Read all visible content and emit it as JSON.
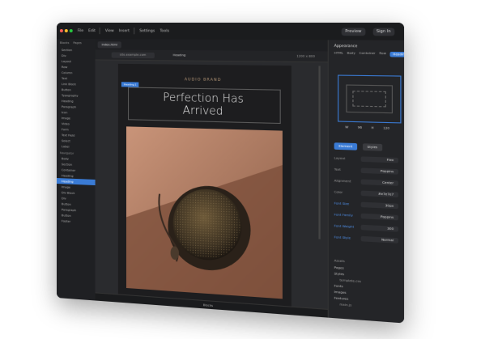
{
  "topbar": {
    "buttons": [
      "File",
      "Edit",
      "View",
      "Insert",
      "Settings",
      "Tools"
    ],
    "preview_label": "Preview",
    "signin_label": "Sign In"
  },
  "left": {
    "tabs": [
      "Blocks",
      "Pages"
    ],
    "items": [
      "Section",
      "Div",
      "Layout",
      "Row",
      "Column",
      "Text",
      "Link Block",
      "Button",
      "Typography",
      "Heading",
      "Paragraph",
      "Icon",
      "Image",
      "Video",
      "Form",
      "Text Field",
      "Select",
      "Label"
    ],
    "section_label": "Navigator",
    "nav_items": [
      "Body",
      "Section",
      "Container",
      "Heading",
      "Heading",
      "Image",
      "Div Block",
      "Div",
      "Button",
      "Paragraph",
      "Button",
      "Footer"
    ],
    "selected_nav_index": 4
  },
  "canvas": {
    "tab_label": "index.html",
    "url": "site.example.com",
    "heading_tag": "Heading",
    "size_label": "1200 x 800",
    "brand": "AUDIO BRAND",
    "selection_tag": "Heading 1",
    "headline_l1": "Perfection Has",
    "headline_l2": "Arrived",
    "status_center": "Blocks"
  },
  "right": {
    "title": "Appearance",
    "modes": [
      "HTML",
      "Body",
      "Container",
      "Row",
      "Heading"
    ],
    "active_mode_index": 4,
    "dims": [
      "W",
      "96",
      "H",
      "120"
    ],
    "btn_primary": "Element",
    "btn_secondary": "Styles",
    "props": [
      {
        "label": "Layout",
        "value": "Flex"
      },
      {
        "label": "Text",
        "value": "Poppins"
      },
      {
        "label": "Alignment",
        "value": "Center"
      },
      {
        "label": "Color",
        "value": "#e7e7e7"
      },
      {
        "label": "Font Size",
        "value": "30px"
      },
      {
        "label": "Font Family",
        "value": "Poppins"
      },
      {
        "label": "Font Weight",
        "value": "300"
      },
      {
        "label": "Font Style",
        "value": "Normal"
      }
    ],
    "tree_head": "Assets",
    "tree": [
      "Pages",
      "Styles",
      "template.css",
      "Fonts",
      "Images",
      "Features",
      "main.js"
    ]
  },
  "colors": {
    "accent": "#3a7bd5",
    "window_bg": "#232427",
    "headline": "#e7e7e7",
    "brand_text": "#b89a7a"
  }
}
